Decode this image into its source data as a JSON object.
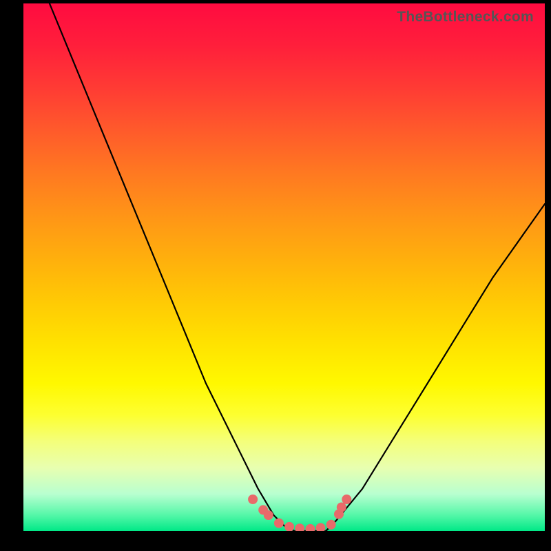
{
  "watermark": "TheBottleneck.com",
  "chart_data": {
    "type": "line",
    "title": "",
    "xlabel": "",
    "ylabel": "",
    "xlim": [
      0,
      100
    ],
    "ylim": [
      0,
      100
    ],
    "series": [
      {
        "name": "bottleneck-curve",
        "x": [
          5,
          10,
          15,
          20,
          25,
          30,
          35,
          40,
          45,
          48,
          50,
          52,
          55,
          58,
          60,
          65,
          70,
          75,
          80,
          85,
          90,
          95,
          100
        ],
        "values": [
          100,
          88,
          76,
          64,
          52,
          40,
          28,
          18,
          8,
          3,
          1,
          0,
          0,
          0,
          2,
          8,
          16,
          24,
          32,
          40,
          48,
          55,
          62
        ]
      }
    ],
    "markers": {
      "name": "anomaly-points",
      "color": "#e86a6a",
      "points": [
        {
          "x": 44,
          "y": 6
        },
        {
          "x": 46,
          "y": 4
        },
        {
          "x": 47,
          "y": 3
        },
        {
          "x": 49,
          "y": 1.5
        },
        {
          "x": 51,
          "y": 0.8
        },
        {
          "x": 53,
          "y": 0.5
        },
        {
          "x": 55,
          "y": 0.4
        },
        {
          "x": 57,
          "y": 0.6
        },
        {
          "x": 59,
          "y": 1.2
        },
        {
          "x": 60.5,
          "y": 3.2
        },
        {
          "x": 61,
          "y": 4.5
        },
        {
          "x": 62,
          "y": 6
        }
      ]
    },
    "background_gradient": {
      "top_color": "#ff0b40",
      "bottom_color": "#00e887"
    }
  }
}
